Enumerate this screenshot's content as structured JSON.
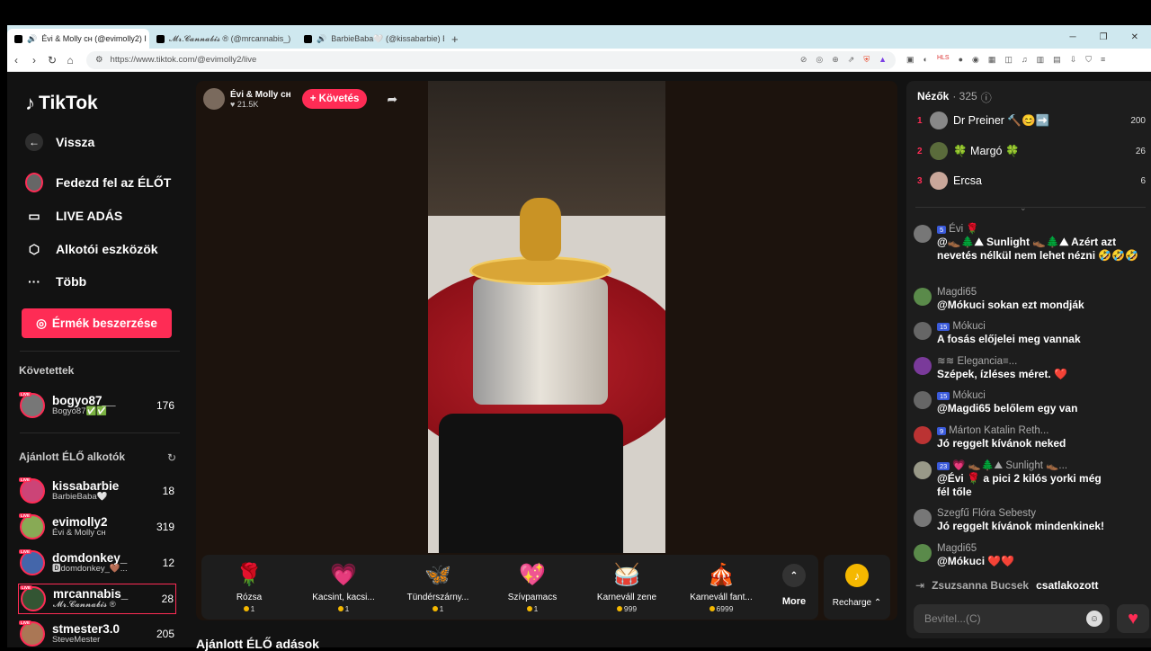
{
  "browser": {
    "tabs": [
      {
        "title": "Évi & Molly ᴄʜ (@evimolly2) I"
      },
      {
        "title": "𝓜𝓻.𝓒𝓪𝓷𝓷𝓪𝓫𝓲𝓼 ® (@mrcannabis_)"
      },
      {
        "title": "BarbieBaba🤍 (@kissabarbie) ÉL"
      }
    ],
    "url": "https://www.tiktok.com/@evimolly2/live"
  },
  "sidebar": {
    "logo": "TikTok",
    "back": "Vissza",
    "nav": [
      {
        "label": "Fedezd fel az ÉLŐT",
        "icon": "explore-live-icon"
      },
      {
        "label": "LIVE ADÁS",
        "icon": "camera-icon"
      },
      {
        "label": "Alkotói eszközök",
        "icon": "creator-tools-icon"
      },
      {
        "label": "Több",
        "icon": "more-icon"
      }
    ],
    "coins_button": "Érmék beszerzése",
    "following_title": "Követettek",
    "following": [
      {
        "name": "bogyo87__",
        "sub": "Bogyó87✅✅",
        "count": "176"
      }
    ],
    "recommended_title": "Ajánlott ÉLŐ alkotók",
    "recommended": [
      {
        "name": "kissabarbie",
        "sub": "BarbieBaba🤍",
        "count": "18"
      },
      {
        "name": "evimolly2",
        "sub": "Évi & Molly ᴄʜ",
        "count": "319"
      },
      {
        "name": "domdonkey_",
        "sub": "🅳domdonkey_🤎...",
        "count": "12"
      },
      {
        "name": "mrcannabis_",
        "sub": "𝓜𝓻.𝓒𝓪𝓷𝓷𝓪𝓫𝓲𝓼 ®",
        "count": "28"
      },
      {
        "name": "stmester3.0",
        "sub": "SteveMester",
        "count": "205"
      }
    ],
    "live_badge": "LIVE"
  },
  "stream": {
    "streamer": "Évi & Molly ᴄʜ",
    "likes": "♥ 21.5K",
    "follow": "+ Követés",
    "below_title": "Ajánlott ÉLŐ adások"
  },
  "gifts": [
    {
      "name": "Rózsa",
      "price": "1",
      "icon": "rose-icon"
    },
    {
      "name": "Kacsint, kacsi...",
      "price": "1",
      "icon": "heart-wink-icon"
    },
    {
      "name": "Tündérszárny...",
      "price": "1",
      "icon": "fairy-wings-icon"
    },
    {
      "name": "Szívpamacs",
      "price": "1",
      "icon": "heart-puff-icon"
    },
    {
      "name": "Karneváll zene",
      "price": "999",
      "icon": "carnival-drum-icon"
    },
    {
      "name": "Karneváll fant...",
      "price": "6999",
      "icon": "carnival-float-icon"
    }
  ],
  "more_label": "More",
  "recharge_label": "Recharge ⌃",
  "viewers": {
    "title": "Nézők",
    "count": "· 325",
    "top": [
      {
        "rank": "1",
        "name": "Dr Preiner 🔨😊➡️",
        "score": "200"
      },
      {
        "rank": "2",
        "name": "🍀 Margó 🍀",
        "score": "26"
      },
      {
        "rank": "3",
        "name": "Ercsa",
        "score": "6"
      }
    ]
  },
  "chat": [
    {
      "user": "Évi 🌹",
      "badge": "5",
      "text": "@👞🌲⛰ Sunlight 👞🌲⛰ Azért azt nevetés nélkül nem lehet nézni 🤣🤣🤣"
    },
    {
      "user": "Magdi65",
      "badge": "",
      "text": "@Mókuci sokan ezt mondják"
    },
    {
      "user": "Mókuci",
      "badge": "15",
      "text": "A fosás előjelei meg vannak"
    },
    {
      "user": "≋≋ Elegancia≡...",
      "badge": "",
      "text": "Szépek, ízléses méret. ❤️"
    },
    {
      "user": "Mókuci",
      "badge": "15",
      "text": "@Magdi65 belőlem egy van"
    },
    {
      "user": "Márton Katalin Reth...",
      "badge": "9",
      "text": "Jó reggelt kívánok neked"
    },
    {
      "user": "💗 👞🌲⛰ Sunlight 👞...",
      "badge": "23",
      "text": "@Évi 🌹 a pici 2 kilós yorki még fél tőle"
    },
    {
      "user": "Szegfű Flóra Sebesty",
      "badge": "",
      "text": "Jó reggelt kívánok mindenkinek!"
    },
    {
      "user": "Magdi65",
      "badge": "",
      "text": "@Mókuci ❤️❤️"
    }
  ],
  "joined": {
    "user": "Zsuzsanna Bucsek",
    "text": "csatlakozott"
  },
  "chat_input_placeholder": "Bevitel...(C)",
  "colors": {
    "accent": "#fe2c55",
    "bg": "#121212",
    "panel": "#1d1d1d"
  }
}
